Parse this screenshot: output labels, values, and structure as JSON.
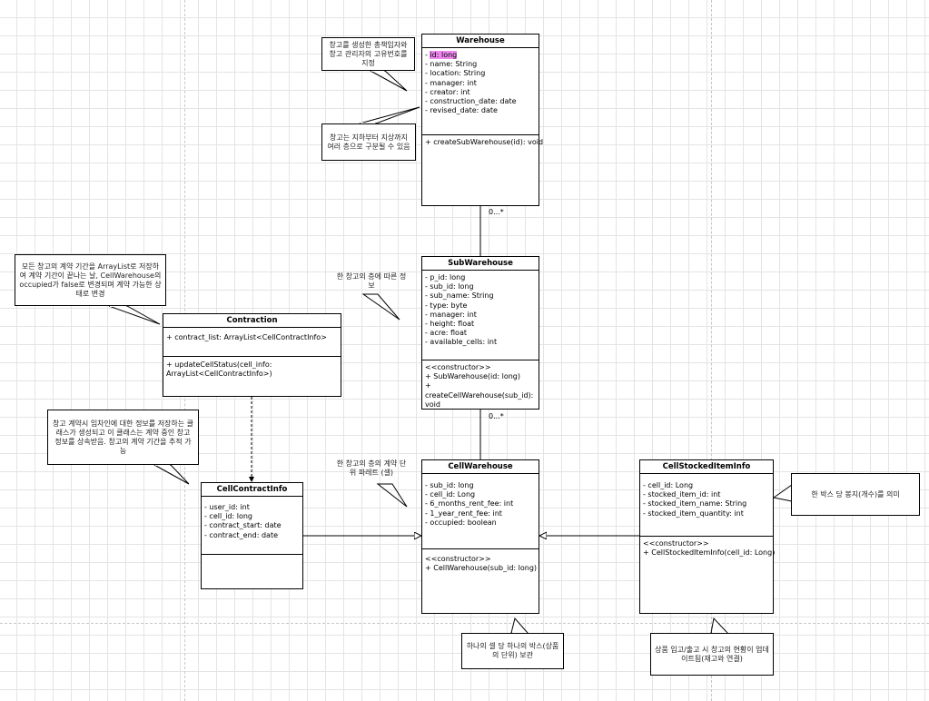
{
  "classes": {
    "warehouse": {
      "name": "Warehouse",
      "id_attr": "id: long",
      "attributes": [
        "- name: String",
        "- location: String",
        "- manager: int",
        "- creator: int",
        "- construction_date: date",
        "- revised_date: date"
      ],
      "methods": [
        "+ createSubWarehouse(id): void"
      ]
    },
    "subwarehouse": {
      "name": "SubWarehouse",
      "attributes": [
        "- p_id: long",
        "- sub_id: long",
        "- sub_name: String",
        "- type: byte",
        "- manager: int",
        "- height: float",
        "- acre: float",
        "- available_cells: int"
      ],
      "methods": [
        "<<constructor>>",
        "+ SubWarehouse(id: long)",
        "+ createCellWarehouse(sub_id): void"
      ]
    },
    "cellwarehouse": {
      "name": "CellWarehouse",
      "attributes": [
        "- sub_id: long",
        "- cell_id: Long",
        "- 6_months_rent_fee: int",
        "- 1_year_rent_fee: int",
        "- occupied: boolean"
      ],
      "methods": [
        "<<constructor>>",
        "+ CellWarehouse(sub_id: long)"
      ]
    },
    "contraction": {
      "name": "Contraction",
      "attributes": [
        "+ contract_list: ArrayList<CellContractInfo>"
      ],
      "methods": [
        "+ updateCellStatus(cell_info: ArrayList<CellContractInfo>)"
      ]
    },
    "cellcontractinfo": {
      "name": "CellContractInfo",
      "attributes": [
        "- user_id: int",
        "- cell_id: long",
        "- contract_start: date",
        "- contract_end: date"
      ]
    },
    "cellstockediteminfo": {
      "name": "CellStockedItemInfo",
      "attributes": [
        "- cell_id: Long",
        "- stocked_item_id: int",
        "- stocked_item_name: String",
        "- stocked_item_quantity: int"
      ],
      "methods": [
        "<<constructor>>",
        "+ CellStockedItemInfo(cell_id: Long)"
      ]
    }
  },
  "multiplicities": {
    "warehouse_sub": "0...*",
    "sub_cell": "0...*"
  },
  "notes": {
    "warehouse_ids": "창고를 생성한 총책임자와 창고 관리자의 고유번호를 지정",
    "warehouse_floors": "창고는 지하부터 지상까지 여러 층으로 구분될 수 있음",
    "subwarehouse_floor": "한 창고의 층에 따른 정보",
    "contraction_info": "모든 창고의 계약 기간을 ArrayList로 저장하여 계약 기간이 끝나는 날, CellWarehouse의 occupied가 false로 변경되며 계약 가능한 상태로 변경",
    "contract_info": "창고 계약시 임차인에 대한 정보를 저장하는 클래스가 생성되고 이 클래스는 계약 중인 창고 정보를 상속받음. 창고의 계약 기간을 추적 가능",
    "cell_unit": "한 창고의 층의 계약 단위 파레트 (셀)",
    "box_unit": "하나의 셀 당 하나의 박스(상품의 단위) 보관",
    "box_quantity": "한 박스 당 봉지(개수)를 의미",
    "stock_update": "상품 입고/출고 시 창고의 현황이 업데이트됨(재고와 연결)"
  },
  "colors": {
    "highlight": "#ee88ee",
    "line": "#000000",
    "grid": "#e4e4e4"
  }
}
